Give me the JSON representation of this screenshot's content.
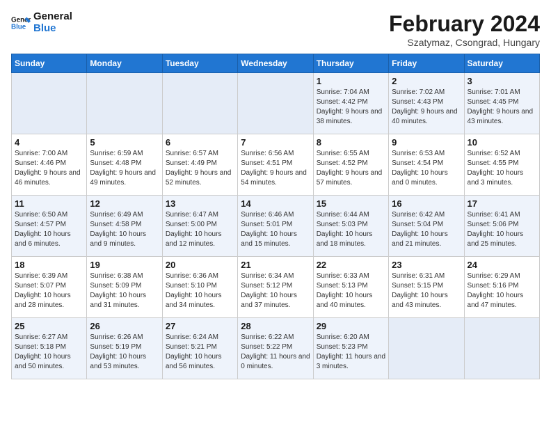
{
  "logo": {
    "line1": "General",
    "line2": "Blue"
  },
  "title": "February 2024",
  "subtitle": "Szatymaz, Csongrad, Hungary",
  "days_of_week": [
    "Sunday",
    "Monday",
    "Tuesday",
    "Wednesday",
    "Thursday",
    "Friday",
    "Saturday"
  ],
  "weeks": [
    [
      {
        "day": "",
        "empty": true
      },
      {
        "day": "",
        "empty": true
      },
      {
        "day": "",
        "empty": true
      },
      {
        "day": "",
        "empty": true
      },
      {
        "day": "1",
        "sunrise": "7:04 AM",
        "sunset": "4:42 PM",
        "daylight": "9 hours and 38 minutes."
      },
      {
        "day": "2",
        "sunrise": "7:02 AM",
        "sunset": "4:43 PM",
        "daylight": "9 hours and 40 minutes."
      },
      {
        "day": "3",
        "sunrise": "7:01 AM",
        "sunset": "4:45 PM",
        "daylight": "9 hours and 43 minutes."
      }
    ],
    [
      {
        "day": "4",
        "sunrise": "7:00 AM",
        "sunset": "4:46 PM",
        "daylight": "9 hours and 46 minutes."
      },
      {
        "day": "5",
        "sunrise": "6:59 AM",
        "sunset": "4:48 PM",
        "daylight": "9 hours and 49 minutes."
      },
      {
        "day": "6",
        "sunrise": "6:57 AM",
        "sunset": "4:49 PM",
        "daylight": "9 hours and 52 minutes."
      },
      {
        "day": "7",
        "sunrise": "6:56 AM",
        "sunset": "4:51 PM",
        "daylight": "9 hours and 54 minutes."
      },
      {
        "day": "8",
        "sunrise": "6:55 AM",
        "sunset": "4:52 PM",
        "daylight": "9 hours and 57 minutes."
      },
      {
        "day": "9",
        "sunrise": "6:53 AM",
        "sunset": "4:54 PM",
        "daylight": "10 hours and 0 minutes."
      },
      {
        "day": "10",
        "sunrise": "6:52 AM",
        "sunset": "4:55 PM",
        "daylight": "10 hours and 3 minutes."
      }
    ],
    [
      {
        "day": "11",
        "sunrise": "6:50 AM",
        "sunset": "4:57 PM",
        "daylight": "10 hours and 6 minutes."
      },
      {
        "day": "12",
        "sunrise": "6:49 AM",
        "sunset": "4:58 PM",
        "daylight": "10 hours and 9 minutes."
      },
      {
        "day": "13",
        "sunrise": "6:47 AM",
        "sunset": "5:00 PM",
        "daylight": "10 hours and 12 minutes."
      },
      {
        "day": "14",
        "sunrise": "6:46 AM",
        "sunset": "5:01 PM",
        "daylight": "10 hours and 15 minutes."
      },
      {
        "day": "15",
        "sunrise": "6:44 AM",
        "sunset": "5:03 PM",
        "daylight": "10 hours and 18 minutes."
      },
      {
        "day": "16",
        "sunrise": "6:42 AM",
        "sunset": "5:04 PM",
        "daylight": "10 hours and 21 minutes."
      },
      {
        "day": "17",
        "sunrise": "6:41 AM",
        "sunset": "5:06 PM",
        "daylight": "10 hours and 25 minutes."
      }
    ],
    [
      {
        "day": "18",
        "sunrise": "6:39 AM",
        "sunset": "5:07 PM",
        "daylight": "10 hours and 28 minutes."
      },
      {
        "day": "19",
        "sunrise": "6:38 AM",
        "sunset": "5:09 PM",
        "daylight": "10 hours and 31 minutes."
      },
      {
        "day": "20",
        "sunrise": "6:36 AM",
        "sunset": "5:10 PM",
        "daylight": "10 hours and 34 minutes."
      },
      {
        "day": "21",
        "sunrise": "6:34 AM",
        "sunset": "5:12 PM",
        "daylight": "10 hours and 37 minutes."
      },
      {
        "day": "22",
        "sunrise": "6:33 AM",
        "sunset": "5:13 PM",
        "daylight": "10 hours and 40 minutes."
      },
      {
        "day": "23",
        "sunrise": "6:31 AM",
        "sunset": "5:15 PM",
        "daylight": "10 hours and 43 minutes."
      },
      {
        "day": "24",
        "sunrise": "6:29 AM",
        "sunset": "5:16 PM",
        "daylight": "10 hours and 47 minutes."
      }
    ],
    [
      {
        "day": "25",
        "sunrise": "6:27 AM",
        "sunset": "5:18 PM",
        "daylight": "10 hours and 50 minutes."
      },
      {
        "day": "26",
        "sunrise": "6:26 AM",
        "sunset": "5:19 PM",
        "daylight": "10 hours and 53 minutes."
      },
      {
        "day": "27",
        "sunrise": "6:24 AM",
        "sunset": "5:21 PM",
        "daylight": "10 hours and 56 minutes."
      },
      {
        "day": "28",
        "sunrise": "6:22 AM",
        "sunset": "5:22 PM",
        "daylight": "11 hours and 0 minutes."
      },
      {
        "day": "29",
        "sunrise": "6:20 AM",
        "sunset": "5:23 PM",
        "daylight": "11 hours and 3 minutes."
      },
      {
        "day": "",
        "empty": true
      },
      {
        "day": "",
        "empty": true
      }
    ]
  ]
}
